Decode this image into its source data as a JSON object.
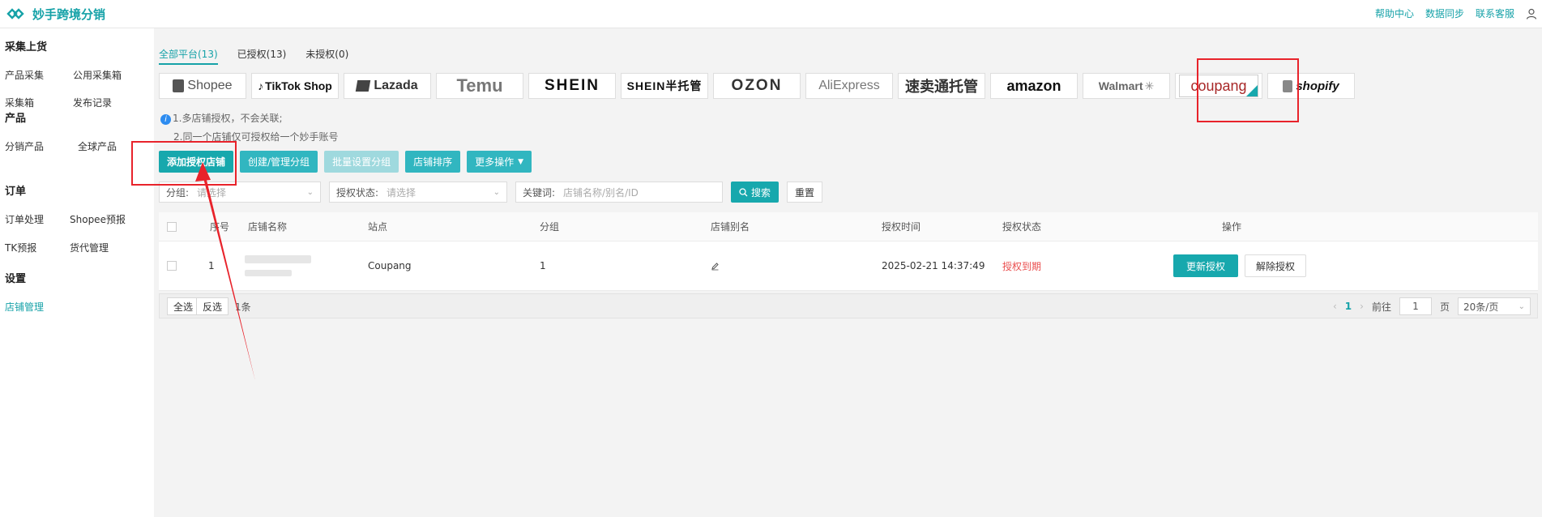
{
  "app": {
    "title": "妙手跨境分销"
  },
  "top_links": [
    "帮助中心",
    "数据同步",
    "联系客服"
  ],
  "sidebar": {
    "groups": [
      {
        "title": "采集上货",
        "items": [
          "产品采集",
          "公用采集箱",
          "采集箱",
          "发布记录"
        ]
      },
      {
        "title": "产品",
        "items": [
          "分销产品",
          "全球产品"
        ]
      },
      {
        "title": "订单",
        "items": [
          "订单处理",
          "Shopee预报",
          "TK预报",
          "货代管理"
        ]
      },
      {
        "title": "设置",
        "items": [
          "店铺管理"
        ]
      }
    ],
    "active_item": "店铺管理"
  },
  "tabs": [
    "全部平台(13)",
    "已授权(13)",
    "未授权(0)"
  ],
  "platforms": [
    "Shopee",
    "TikTok Shop",
    "Lazada",
    "Temu",
    "SHEIN",
    "SHEIN半托管",
    "OZON",
    "AliExpress",
    "速卖通托管",
    "amazon",
    "Walmart",
    "coupang",
    "shopify"
  ],
  "selected_platform": "coupang",
  "tips": [
    "1.多店铺授权，不会关联;",
    "2.同一个店铺仅可授权给一个妙手账号"
  ],
  "actions": {
    "add_store": "添加授权店铺",
    "manage_groups": "创建/管理分组",
    "batch_group": "批量设置分组",
    "sort_stores": "店铺排序",
    "more": "更多操作"
  },
  "filters": {
    "group_label": "分组:",
    "group_placeholder": "请选择",
    "status_label": "授权状态:",
    "status_placeholder": "请选择",
    "keyword_label": "关键词:",
    "keyword_placeholder": "店铺名称/别名/ID",
    "search": "搜索",
    "reset": "重置"
  },
  "table": {
    "columns": [
      "序号",
      "店铺名称",
      "站点",
      "分组",
      "店铺别名",
      "授权时间",
      "授权状态",
      "操作"
    ],
    "rows": [
      {
        "index": "1",
        "site": "Coupang",
        "group": "1",
        "auth_time": "2025-02-21 14:37:49",
        "status": "授权到期",
        "update_btn": "更新授权",
        "unbind_btn": "解除授权"
      }
    ]
  },
  "footer": {
    "select_all": "全选",
    "invert": "反选",
    "count": "1条",
    "page": "1",
    "goto_label": "前往",
    "goto_value": "1",
    "page_suffix": "页",
    "page_size": "20条/页"
  },
  "colors": {
    "accent": "#17a8ad",
    "expired": "#ea4e4e",
    "annotation": "#e8232b"
  }
}
